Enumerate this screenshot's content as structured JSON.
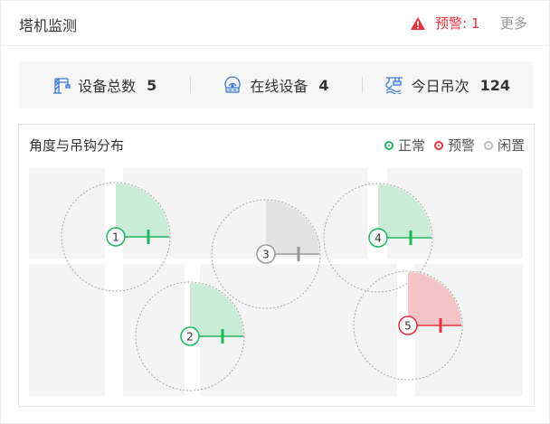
{
  "header": {
    "title": "塔机监测",
    "warning_label": "预警: 1",
    "more_label": "更多"
  },
  "stats": [
    {
      "label": "设备总数",
      "value": "5",
      "icon": "tower-crane-icon"
    },
    {
      "label": "在线设备",
      "value": "4",
      "icon": "online-device-icon"
    },
    {
      "label": "今日吊次",
      "value": "124",
      "icon": "hook-lift-icon"
    }
  ],
  "panel": {
    "title": "角度与吊钩分布",
    "legend": [
      {
        "label": "正常",
        "color": "#1db85c"
      },
      {
        "label": "预警",
        "color": "#e8333f"
      },
      {
        "label": "闲置",
        "color": "#bbbbbb"
      }
    ]
  },
  "cranes": [
    {
      "id": "1",
      "status": "normal"
    },
    {
      "id": "2",
      "status": "normal"
    },
    {
      "id": "3",
      "status": "idle"
    },
    {
      "id": "4",
      "status": "normal"
    },
    {
      "id": "5",
      "status": "warning"
    }
  ],
  "colors": {
    "normal_stroke": "#1db85c",
    "normal_fill": "#c9ecd7",
    "warning_stroke": "#e8333f",
    "warning_fill": "#f2c4c6",
    "idle_stroke": "#999999",
    "idle_fill": "#e2e2e2"
  }
}
